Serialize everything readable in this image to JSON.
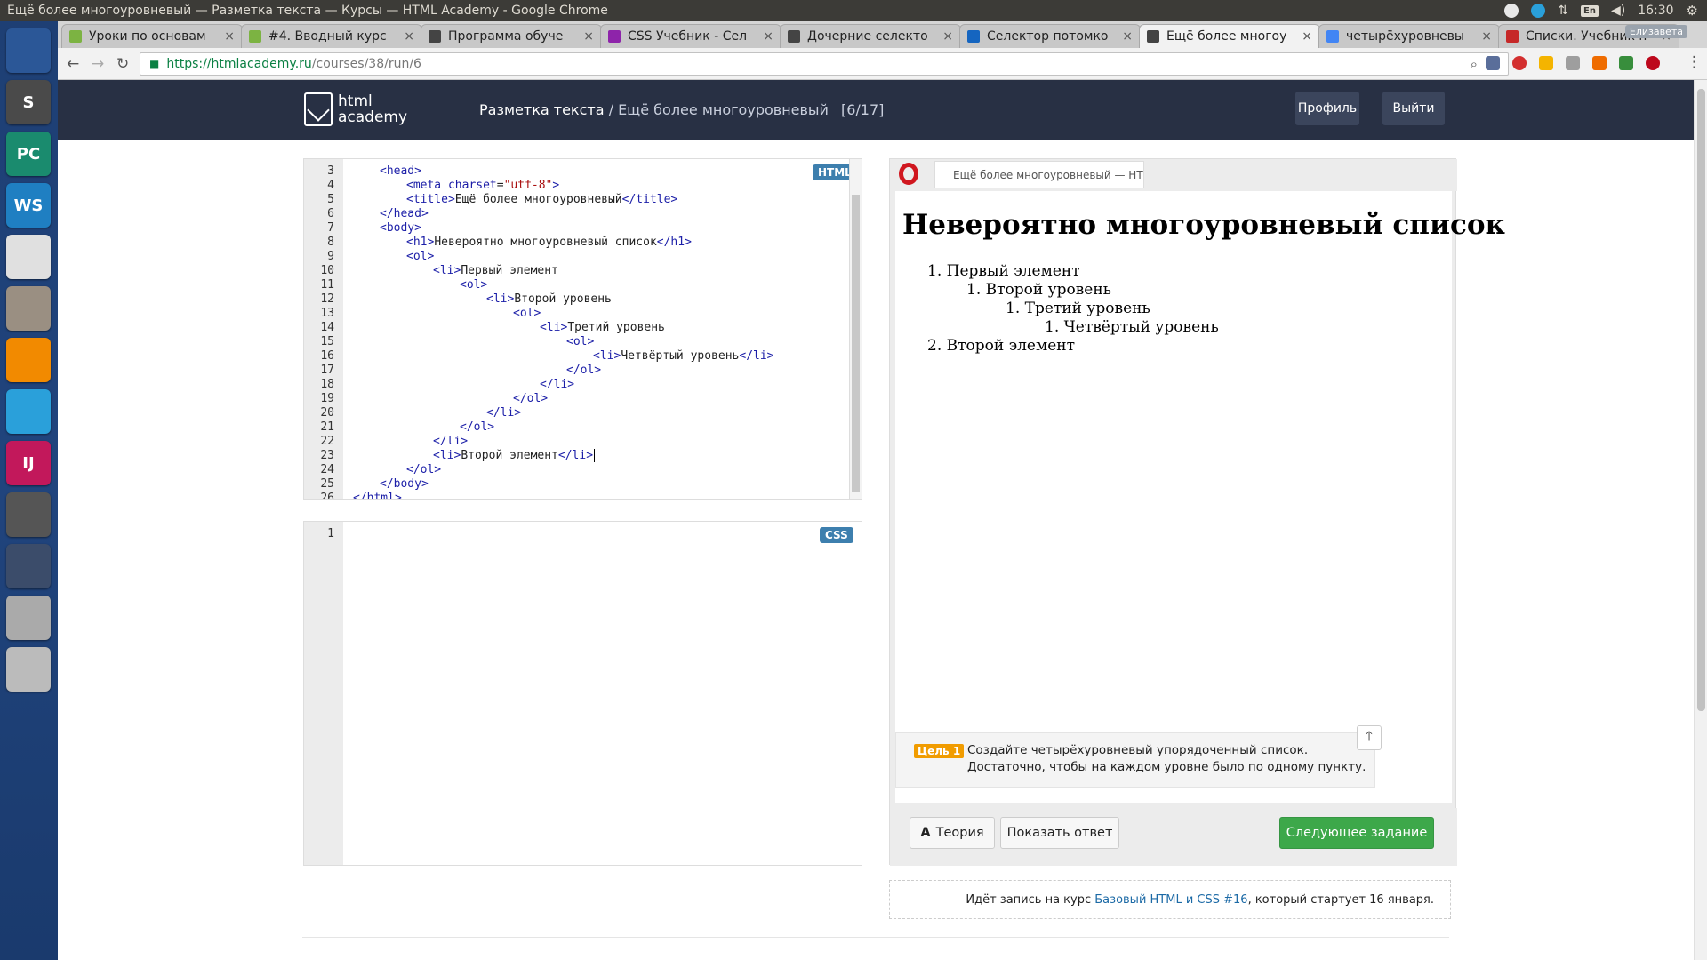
{
  "os": {
    "window_title": "Ещё более многоуровневый — Разметка текста — Курсы — HTML Academy - Google Chrome",
    "lang": "En",
    "clock": "16:30",
    "launcher": [
      {
        "name": "ubuntu-dash-icon",
        "glyph": "",
        "color": "#2b5797"
      },
      {
        "name": "sublime-text-icon",
        "glyph": "S",
        "color": "#4a4a4a"
      },
      {
        "name": "pycharm-icon",
        "glyph": "PC",
        "color": "#1a8b6e"
      },
      {
        "name": "webstorm-icon",
        "glyph": "WS",
        "color": "#1f7fc2"
      },
      {
        "name": "chrome-icon",
        "glyph": "",
        "color": "#e0e0e0"
      },
      {
        "name": "files-icon",
        "glyph": "",
        "color": "#9a8f82"
      },
      {
        "name": "vlc-icon",
        "glyph": "",
        "color": "#f28a00"
      },
      {
        "name": "telegram-icon",
        "glyph": "",
        "color": "#2aa0da"
      },
      {
        "name": "intellij-icon",
        "glyph": "IJ",
        "color": "#c2185b"
      },
      {
        "name": "software-updater-icon",
        "glyph": "",
        "color": "#555555"
      },
      {
        "name": "workspace-switcher-icon",
        "glyph": "",
        "color": "#3b4c6a"
      },
      {
        "name": "drive-icon",
        "glyph": "",
        "color": "#aaaaaa"
      },
      {
        "name": "trash-icon",
        "glyph": "",
        "color": "#bbbbbb"
      }
    ]
  },
  "browser": {
    "tabs": [
      {
        "label": "Уроки по основам",
        "color": "#7cb342"
      },
      {
        "label": "#4. Вводный курс",
        "color": "#7cb342"
      },
      {
        "label": "Программа обуче",
        "color": "#444444"
      },
      {
        "label": "CSS Учебник - Сел",
        "color": "#8e24aa"
      },
      {
        "label": "Дочерние селекто",
        "color": "#444444"
      },
      {
        "label": "Селектор потомко",
        "color": "#1565c0"
      },
      {
        "label": "Ещё более многоу",
        "color": "#444444"
      },
      {
        "label": "четырёхуровневы",
        "color": "#4285f4"
      },
      {
        "label": "Списки. Учебник h",
        "color": "#c62828"
      }
    ],
    "user": "Елизавета",
    "url_host": "https://htmlacademy.ru",
    "url_path": "/courses/38/run/6"
  },
  "site": {
    "logo_line1": "html",
    "logo_line2": "academy",
    "section": "Разметка текста",
    "separator": " / ",
    "lesson": "Ещё более многоуровневый",
    "counter": "[6/17]",
    "profile_button": "Профиль",
    "logout_button": "Выйти"
  },
  "html_editor": {
    "badge": "HTML",
    "lines": [
      {
        "n": "3",
        "indent": 1,
        "parts": [
          [
            "tag",
            "<head>"
          ]
        ]
      },
      {
        "n": "4",
        "indent": 2,
        "parts": [
          [
            "tag",
            "<meta "
          ],
          [
            "attr",
            "charset"
          ],
          [
            "txt",
            "="
          ],
          [
            "str",
            "\"utf-8\""
          ],
          [
            "tag",
            ">"
          ]
        ]
      },
      {
        "n": "5",
        "indent": 2,
        "parts": [
          [
            "tag",
            "<title>"
          ],
          [
            "txt",
            "Ещё более многоуровневый"
          ],
          [
            "tag",
            "</title>"
          ]
        ]
      },
      {
        "n": "6",
        "indent": 1,
        "parts": [
          [
            "tag",
            "</head>"
          ]
        ]
      },
      {
        "n": "7",
        "indent": 1,
        "parts": [
          [
            "tag",
            "<body>"
          ]
        ]
      },
      {
        "n": "8",
        "indent": 2,
        "parts": [
          [
            "tag",
            "<h1>"
          ],
          [
            "txt",
            "Невероятно многоуровневый список"
          ],
          [
            "tag",
            "</h1>"
          ]
        ]
      },
      {
        "n": "9",
        "indent": 2,
        "parts": [
          [
            "tag",
            "<ol>"
          ]
        ]
      },
      {
        "n": "10",
        "indent": 3,
        "parts": [
          [
            "tag",
            "<li>"
          ],
          [
            "txt",
            "Первый элемент"
          ]
        ]
      },
      {
        "n": "11",
        "indent": 4,
        "parts": [
          [
            "tag",
            "<ol>"
          ]
        ]
      },
      {
        "n": "12",
        "indent": 5,
        "parts": [
          [
            "tag",
            "<li>"
          ],
          [
            "txt",
            "Второй уровень"
          ]
        ]
      },
      {
        "n": "13",
        "indent": 6,
        "parts": [
          [
            "tag",
            "<ol>"
          ]
        ]
      },
      {
        "n": "14",
        "indent": 7,
        "parts": [
          [
            "tag",
            "<li>"
          ],
          [
            "txt",
            "Третий уровень"
          ]
        ]
      },
      {
        "n": "15",
        "indent": 8,
        "parts": [
          [
            "tag",
            "<ol>"
          ]
        ]
      },
      {
        "n": "16",
        "indent": 9,
        "parts": [
          [
            "tag",
            "<li>"
          ],
          [
            "txt",
            "Четвёртый уровень"
          ],
          [
            "tag",
            "</li>"
          ]
        ]
      },
      {
        "n": "17",
        "indent": 8,
        "parts": [
          [
            "tag",
            "</ol>"
          ]
        ]
      },
      {
        "n": "18",
        "indent": 7,
        "parts": [
          [
            "tag",
            "</li>"
          ]
        ]
      },
      {
        "n": "19",
        "indent": 6,
        "parts": [
          [
            "tag",
            "</ol>"
          ]
        ]
      },
      {
        "n": "20",
        "indent": 5,
        "parts": [
          [
            "tag",
            "</li>"
          ]
        ]
      },
      {
        "n": "21",
        "indent": 4,
        "parts": [
          [
            "tag",
            "</ol>"
          ]
        ]
      },
      {
        "n": "22",
        "indent": 3,
        "parts": [
          [
            "tag",
            "</li>"
          ]
        ]
      },
      {
        "n": "23",
        "indent": 3,
        "parts": [
          [
            "tag",
            "<li>"
          ],
          [
            "txt",
            "Второй элемент"
          ],
          [
            "tag",
            "</li>"
          ]
        ]
      },
      {
        "n": "24",
        "indent": 2,
        "parts": [
          [
            "tag",
            "</ol>"
          ]
        ]
      },
      {
        "n": "25",
        "indent": 1,
        "parts": [
          [
            "tag",
            "</body>"
          ]
        ]
      },
      {
        "n": "26",
        "indent": 0,
        "parts": [
          [
            "tag",
            "</html>"
          ]
        ]
      }
    ]
  },
  "css_editor": {
    "badge": "CSS",
    "line_number": "1"
  },
  "preview": {
    "tab_title": "Ещё более многоуровневый — HT",
    "heading": "Невероятно многоуровневый список",
    "items": [
      {
        "level": 1,
        "text": "1. Первый элемент"
      },
      {
        "level": 2,
        "text": "1. Второй уровень"
      },
      {
        "level": 3,
        "text": "1. Третий уровень"
      },
      {
        "level": 4,
        "text": "1. Четвёртый уровень"
      },
      {
        "level": 1,
        "text": "2. Второй элемент"
      }
    ],
    "goal_label": "Цель 1",
    "goal_text": "Создайте четырёхуровневый упорядоченный список. Достаточно, чтобы на каждом уровне было по одному пункту.",
    "theory_button": "Теория",
    "show_answer_button": "Показать ответ",
    "next_button": "Следующее задание"
  },
  "enroll": {
    "prefix": "Идёт запись на курс ",
    "link": "Базовый HTML и CSS #16",
    "suffix": ", который стартует 16 января."
  }
}
